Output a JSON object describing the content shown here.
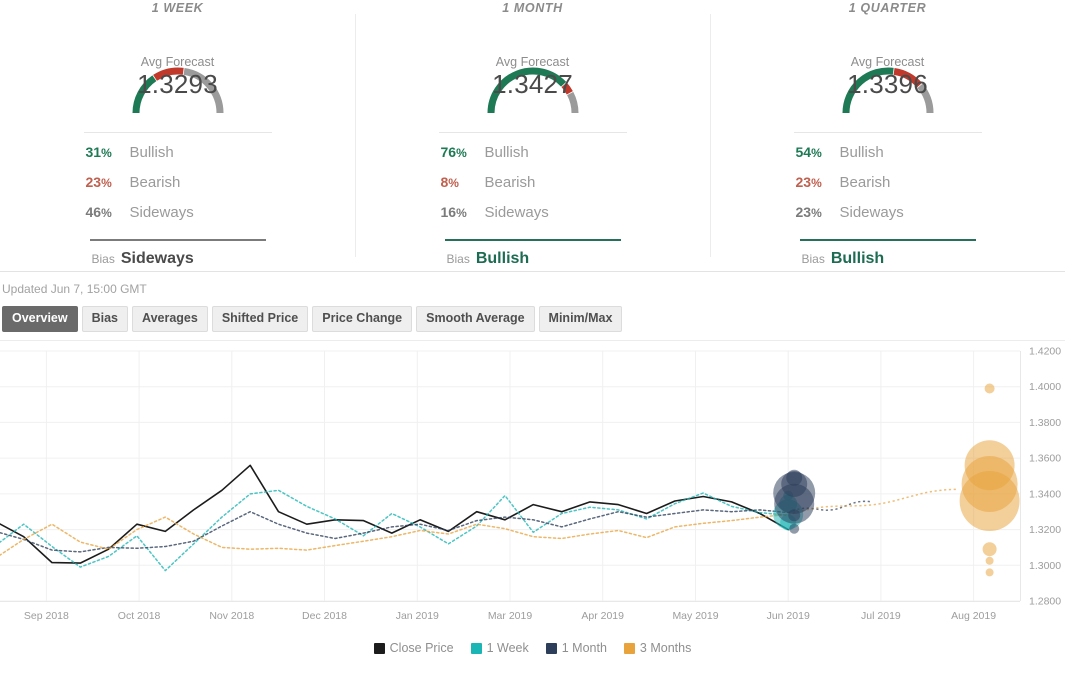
{
  "cards": [
    {
      "title": "1 WEEK",
      "forecast_label": "Avg Forecast",
      "forecast_value": "1.3293",
      "gauge": {
        "bullish": 31,
        "bearish": 23,
        "sideways": 46
      },
      "stats": [
        {
          "pct": "31",
          "sym": "%",
          "name": "Bullish",
          "kind": "bullish"
        },
        {
          "pct": "23",
          "sym": "%",
          "name": "Bearish",
          "kind": "bearish"
        },
        {
          "pct": "46",
          "sym": "%",
          "name": "Sideways",
          "kind": "sideways"
        }
      ],
      "bias_label": "Bias",
      "bias_value": "Sideways",
      "bias_kind": "sideways"
    },
    {
      "title": "1 MONTH",
      "forecast_label": "Avg Forecast",
      "forecast_value": "1.3427",
      "gauge": {
        "bullish": 76,
        "bearish": 8,
        "sideways": 16
      },
      "stats": [
        {
          "pct": "76",
          "sym": "%",
          "name": "Bullish",
          "kind": "bullish"
        },
        {
          "pct": "8",
          "sym": "%",
          "name": "Bearish",
          "kind": "bearish"
        },
        {
          "pct": "16",
          "sym": "%",
          "name": "Sideways",
          "kind": "sideways"
        }
      ],
      "bias_label": "Bias",
      "bias_value": "Bullish",
      "bias_kind": "bullish"
    },
    {
      "title": "1 QUARTER",
      "forecast_label": "Avg Forecast",
      "forecast_value": "1.3396",
      "gauge": {
        "bullish": 54,
        "bearish": 23,
        "sideways": 23
      },
      "stats": [
        {
          "pct": "54",
          "sym": "%",
          "name": "Bullish",
          "kind": "bullish"
        },
        {
          "pct": "23",
          "sym": "%",
          "name": "Bearish",
          "kind": "bearish"
        },
        {
          "pct": "23",
          "sym": "%",
          "name": "Sideways",
          "kind": "sideways"
        }
      ],
      "bias_label": "Bias",
      "bias_value": "Bullish",
      "bias_kind": "bullish"
    }
  ],
  "updated": "Updated Jun 7, 15:00 GMT",
  "tabs": [
    {
      "label": "Overview",
      "active": true
    },
    {
      "label": "Bias",
      "active": false
    },
    {
      "label": "Averages",
      "active": false
    },
    {
      "label": "Shifted Price",
      "active": false
    },
    {
      "label": "Price Change",
      "active": false
    },
    {
      "label": "Smooth Average",
      "active": false
    },
    {
      "label": "Minim/Max",
      "active": false
    }
  ],
  "colors": {
    "bullish": "#1d7a54",
    "bearish": "#c0392b",
    "sideways": "#9b9b9b",
    "close_price": "#1c1c1c",
    "one_week": "#1ab5b5",
    "one_month": "#2c3e5a",
    "three_months": "#e8a33d",
    "grid": "#f0f0f0"
  },
  "chart_data": {
    "type": "line",
    "title": "",
    "xlabel": "",
    "ylabel": "",
    "ylim": [
      1.28,
      1.42
    ],
    "ytick_step": 0.02,
    "ytick_labels": [
      "1.4200",
      "1.4000",
      "1.3800",
      "1.3600",
      "1.3400",
      "1.3200",
      "1.3000",
      "1.2800"
    ],
    "xtick_labels": [
      "Sep 2018",
      "Oct 2018",
      "Nov 2018",
      "Dec 2018",
      "Jan 2019",
      "Mar 2019",
      "Apr 2019",
      "May 2019",
      "Jun 2019",
      "Jul 2019",
      "Aug 2019"
    ],
    "grid": true,
    "legend_position": "bottom",
    "legend": [
      "Close Price",
      "1 Week",
      "1 Month",
      "3 Months"
    ],
    "series": [
      {
        "name": "Close Price",
        "color": "#1c1c1c",
        "style": "solid",
        "values": [
          1.3245,
          1.316,
          1.3015,
          1.3012,
          1.309,
          1.323,
          1.319,
          1.331,
          1.342,
          1.356,
          1.33,
          1.323,
          1.3255,
          1.325,
          1.318,
          1.3255,
          1.319,
          1.33,
          1.3255,
          1.334,
          1.33,
          1.3355,
          1.334,
          1.329,
          1.336,
          1.3385,
          1.3355,
          1.329,
          1.32
        ]
      },
      {
        "name": "1 Week",
        "color": "#1ab5b5",
        "style": "dotted",
        "values": [
          1.311,
          1.323,
          1.3105,
          1.299,
          1.305,
          1.3165,
          1.297,
          1.312,
          1.327,
          1.34,
          1.342,
          1.333,
          1.326,
          1.3165,
          1.329,
          1.3215,
          1.312,
          1.322,
          1.339,
          1.3185,
          1.329,
          1.3325,
          1.331,
          1.326,
          1.3345,
          1.3405,
          1.333,
          1.3295,
          1.328
        ]
      },
      {
        "name": "1 Month",
        "color": "#2c3e5a",
        "style": "dotted",
        "values": [
          1.319,
          1.3145,
          1.3085,
          1.3075,
          1.31,
          1.3095,
          1.3105,
          1.3135,
          1.322,
          1.33,
          1.323,
          1.318,
          1.315,
          1.318,
          1.3215,
          1.323,
          1.3195,
          1.325,
          1.327,
          1.3255,
          1.3215,
          1.326,
          1.33,
          1.327,
          1.329,
          1.331,
          1.33,
          1.331,
          1.3295
        ]
      },
      {
        "name": "3 Months",
        "color": "#e8a33d",
        "style": "dotted",
        "values": [
          1.304,
          1.3145,
          1.323,
          1.313,
          1.309,
          1.32,
          1.327,
          1.3175,
          1.31,
          1.309,
          1.3095,
          1.3085,
          1.311,
          1.3135,
          1.316,
          1.3195,
          1.3175,
          1.323,
          1.3205,
          1.316,
          1.315,
          1.3175,
          1.3195,
          1.3155,
          1.3215,
          1.3235,
          1.325,
          1.327,
          1.3285
        ]
      }
    ],
    "bubbles": [
      {
        "series": "1 Week",
        "x_label": "Jun 2019",
        "value": 1.339,
        "size": 5,
        "color": "#1ab5b5"
      },
      {
        "series": "1 Week",
        "x_label": "Jun 2019",
        "value": 1.3345,
        "size": 9,
        "color": "#1ab5b5"
      },
      {
        "series": "1 Week",
        "x_label": "Jun 2019",
        "value": 1.3285,
        "size": 15,
        "color": "#1ab5b5"
      },
      {
        "series": "1 Week",
        "x_label": "Jun 2019",
        "value": 1.324,
        "size": 8,
        "color": "#1ab5b5"
      },
      {
        "series": "1 Month",
        "x_label": "Jun 2019",
        "value": 1.349,
        "size": 8,
        "color": "#2c3e5a"
      },
      {
        "series": "1 Month",
        "x_label": "Jun 2019",
        "value": 1.3455,
        "size": 13,
        "color": "#2c3e5a"
      },
      {
        "series": "1 Month",
        "x_label": "Jun 2019",
        "value": 1.3405,
        "size": 21,
        "color": "#2c3e5a"
      },
      {
        "series": "1 Month",
        "x_label": "Jun 2019",
        "value": 1.3345,
        "size": 20,
        "color": "#2c3e5a"
      },
      {
        "series": "1 Month",
        "x_label": "Jun 2019",
        "value": 1.328,
        "size": 6,
        "color": "#2c3e5a"
      },
      {
        "series": "1 Month",
        "x_label": "Jun 2019",
        "value": 1.3205,
        "size": 5,
        "color": "#2c3e5a"
      },
      {
        "series": "3 Months",
        "x_label": "Aug 2019",
        "value": 1.399,
        "size": 5,
        "color": "#e8a33d"
      },
      {
        "series": "3 Months",
        "x_label": "Aug 2019",
        "value": 1.356,
        "size": 25,
        "color": "#e8a33d"
      },
      {
        "series": "3 Months",
        "x_label": "Aug 2019",
        "value": 1.3455,
        "size": 28,
        "color": "#e8a33d"
      },
      {
        "series": "3 Months",
        "x_label": "Aug 2019",
        "value": 1.336,
        "size": 30,
        "color": "#e8a33d"
      },
      {
        "series": "3 Months",
        "x_label": "Aug 2019",
        "value": 1.309,
        "size": 7,
        "color": "#e8a33d"
      },
      {
        "series": "3 Months",
        "x_label": "Aug 2019",
        "value": 1.3025,
        "size": 4,
        "color": "#e8a33d"
      },
      {
        "series": "3 Months",
        "x_label": "Aug 2019",
        "value": 1.296,
        "size": 4,
        "color": "#e8a33d"
      }
    ]
  }
}
